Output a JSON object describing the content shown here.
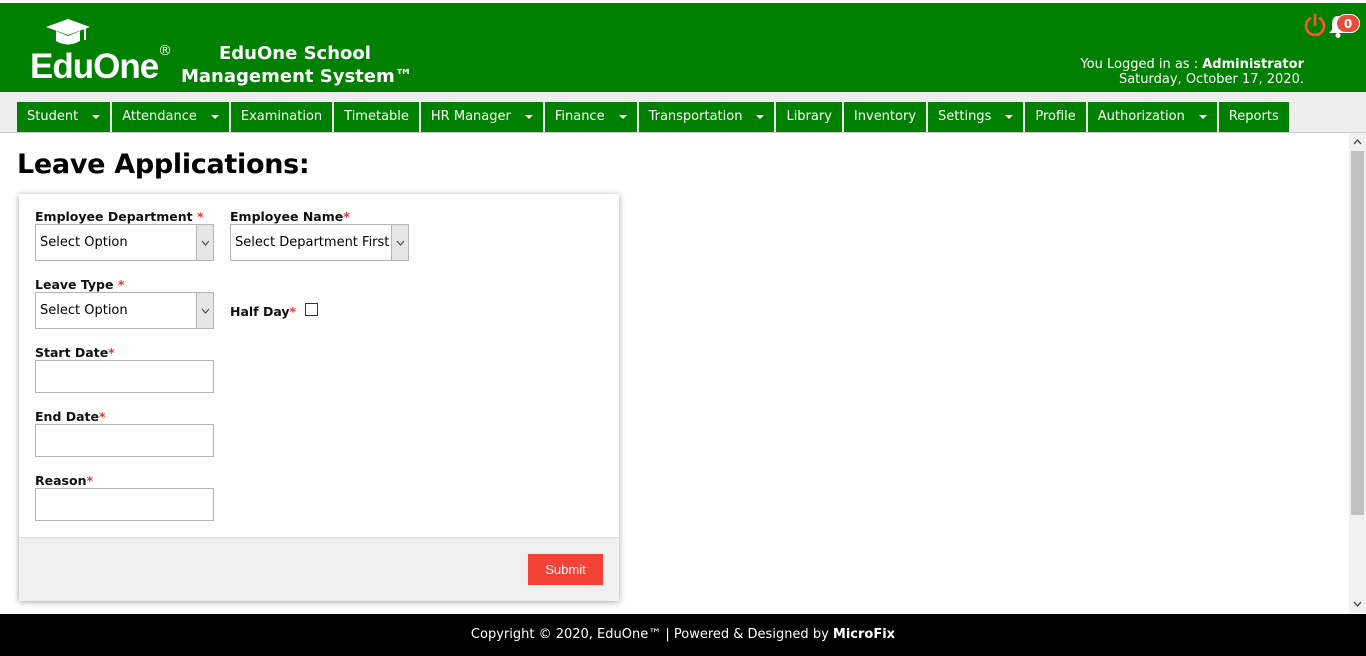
{
  "header": {
    "logo_text": "EduOne",
    "logo_reg": "®",
    "app_title_line1": "EduOne School",
    "app_title_line2": "Management System™",
    "logged_in_prefix": "You Logged in as : ",
    "user_name": "Administrator",
    "date": "Saturday, October 17, 2020.",
    "notification_count": "0",
    "power_icon": "power-icon",
    "bell_icon": "bell-icon",
    "brand_color": "#008000"
  },
  "nav": {
    "items": [
      {
        "label": "Student",
        "dropdown": true
      },
      {
        "label": "Attendance",
        "dropdown": true
      },
      {
        "label": "Examination",
        "dropdown": false
      },
      {
        "label": "Timetable",
        "dropdown": false
      },
      {
        "label": "HR Manager",
        "dropdown": true
      },
      {
        "label": "Finance",
        "dropdown": true
      },
      {
        "label": "Transportation",
        "dropdown": true
      },
      {
        "label": "Library",
        "dropdown": false
      },
      {
        "label": "Inventory",
        "dropdown": false
      },
      {
        "label": "Settings",
        "dropdown": true
      },
      {
        "label": "Profile",
        "dropdown": false
      },
      {
        "label": "Authorization",
        "dropdown": true
      },
      {
        "label": "Reports",
        "dropdown": false
      }
    ]
  },
  "page": {
    "title": "Leave Applications:"
  },
  "form": {
    "department_label": "Employee Department",
    "department_value": "Select Option",
    "employee_name_label": "Employee Name",
    "employee_name_value": "Select Department First",
    "leave_type_label": "Leave Type",
    "leave_type_value": "Select Option",
    "half_day_label": "Half Day",
    "half_day_checked": false,
    "start_date_label": "Start Date",
    "start_date_value": "",
    "end_date_label": "End Date",
    "end_date_value": "",
    "reason_label": "Reason",
    "reason_value": "",
    "required_mark": "*",
    "submit_label": "Submit",
    "submit_color": "#f44336"
  },
  "footer": {
    "text": "Copyright © 2020, EduOne™ | Powered & Designed by ",
    "brand": "MicroFix"
  }
}
